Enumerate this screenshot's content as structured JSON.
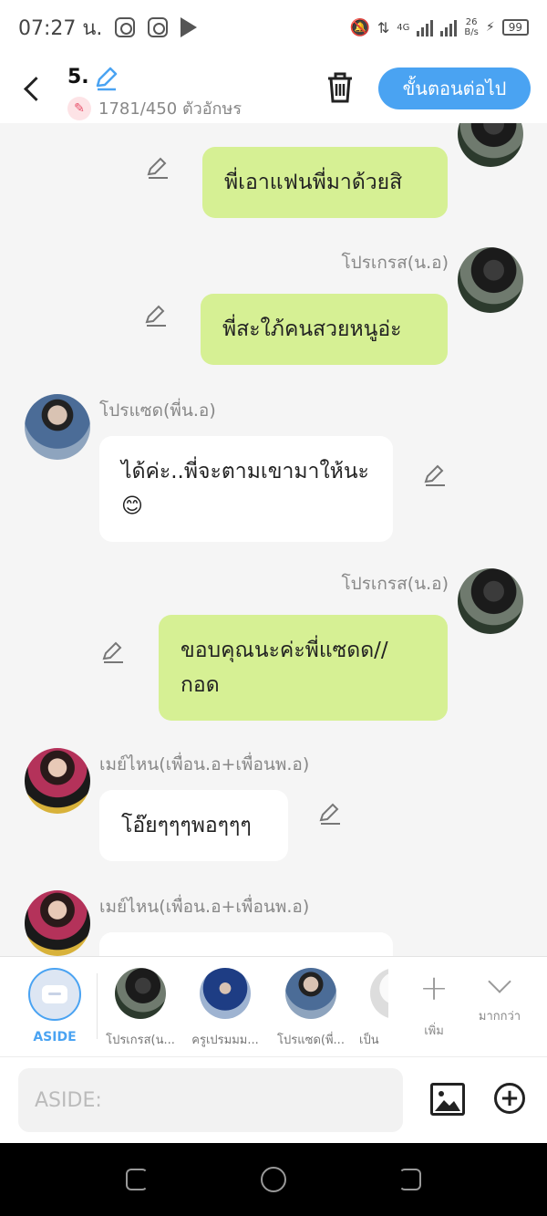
{
  "status_bar": {
    "time": "07:27 น.",
    "network": "4G",
    "net_speed_value": "26",
    "net_speed_unit": "B/s",
    "battery": "99"
  },
  "header": {
    "episode_title": "5.",
    "char_count": "1781/450 ตัวอักษร",
    "next_label": "ขั้นตอนต่อไป",
    "accent_color": "#4aa3f2"
  },
  "messages": [
    {
      "side": "right",
      "sender": "",
      "text": "พี่เอาแฟนพี่มาด้วยสิ",
      "avatar": "dark"
    },
    {
      "side": "right",
      "sender": "โปรเกรส(น.อ)",
      "text": "พี่สะใภ้คนสวยหนูอ่ะ",
      "avatar": "dark"
    },
    {
      "side": "left",
      "sender": "โปรแซด(พี่น.อ)",
      "text": "ได้ค่ะ..พี่จะตามเขามาให้นะ😊",
      "avatar": "denim"
    },
    {
      "side": "right",
      "sender": "โปรเกรส(น.อ)",
      "text": "ขอบคุณนะค่ะพี่แซดด//กอด",
      "avatar": "dark"
    },
    {
      "side": "left",
      "sender": "เมย์ไหน(เพื่อน.อ+เพื่อนพ.อ)",
      "text": "โอ๊ยๆๆๆพอๆๆๆ",
      "avatar": "pink"
    },
    {
      "side": "left",
      "sender": "เมย์ไหน(เพื่อน.อ+เพื่อนพ.อ)",
      "text": "",
      "avatar": "pink"
    }
  ],
  "charbar": {
    "aside_label": "ASIDE",
    "characters": [
      {
        "label": "โปรเกรส(น..."
      },
      {
        "label": "ครูเปรมมม..."
      },
      {
        "label": "โปรแซด(พี่..."
      },
      {
        "label": "เป็น"
      }
    ],
    "add_label": "เพิ่ม",
    "more_label": "มากกว่า"
  },
  "input_bar": {
    "placeholder": "ASIDE:"
  },
  "colors": {
    "my_bubble": "#d6f094",
    "their_bubble": "#ffffff",
    "accent": "#4aa3f2"
  }
}
